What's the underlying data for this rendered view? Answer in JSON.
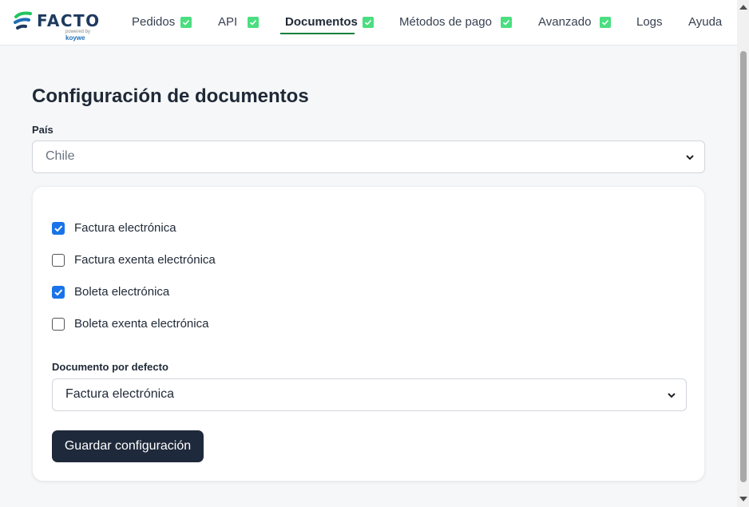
{
  "brand": {
    "name": "FACTO",
    "powered_by": "powered by",
    "partner": "koywe"
  },
  "nav": {
    "items": [
      {
        "label": "Pedidos",
        "checked": true
      },
      {
        "label": "API",
        "checked": true
      },
      {
        "label": "Documentos",
        "checked": true,
        "active": true
      },
      {
        "label": "Métodos de pago",
        "checked": true
      },
      {
        "label": "Avanzado",
        "checked": true
      },
      {
        "label": "Logs",
        "checked": false
      },
      {
        "label": "Ayuda",
        "checked": false
      }
    ]
  },
  "page": {
    "title": "Configuración de documentos",
    "country_label": "País",
    "country_value": "Chile"
  },
  "documents": {
    "options": [
      {
        "label": "Factura electrónica",
        "checked": true
      },
      {
        "label": "Factura exenta electrónica",
        "checked": false
      },
      {
        "label": "Boleta electrónica",
        "checked": true
      },
      {
        "label": "Boleta exenta electrónica",
        "checked": false
      }
    ],
    "default_label": "Documento por defecto",
    "default_value": "Factura electrónica",
    "save_label": "Guardar configuración"
  },
  "colors": {
    "accent_green": "#15803d",
    "check_green": "#4ade80",
    "checkbox_blue": "#1a73e8",
    "button_dark": "#1e293b"
  }
}
